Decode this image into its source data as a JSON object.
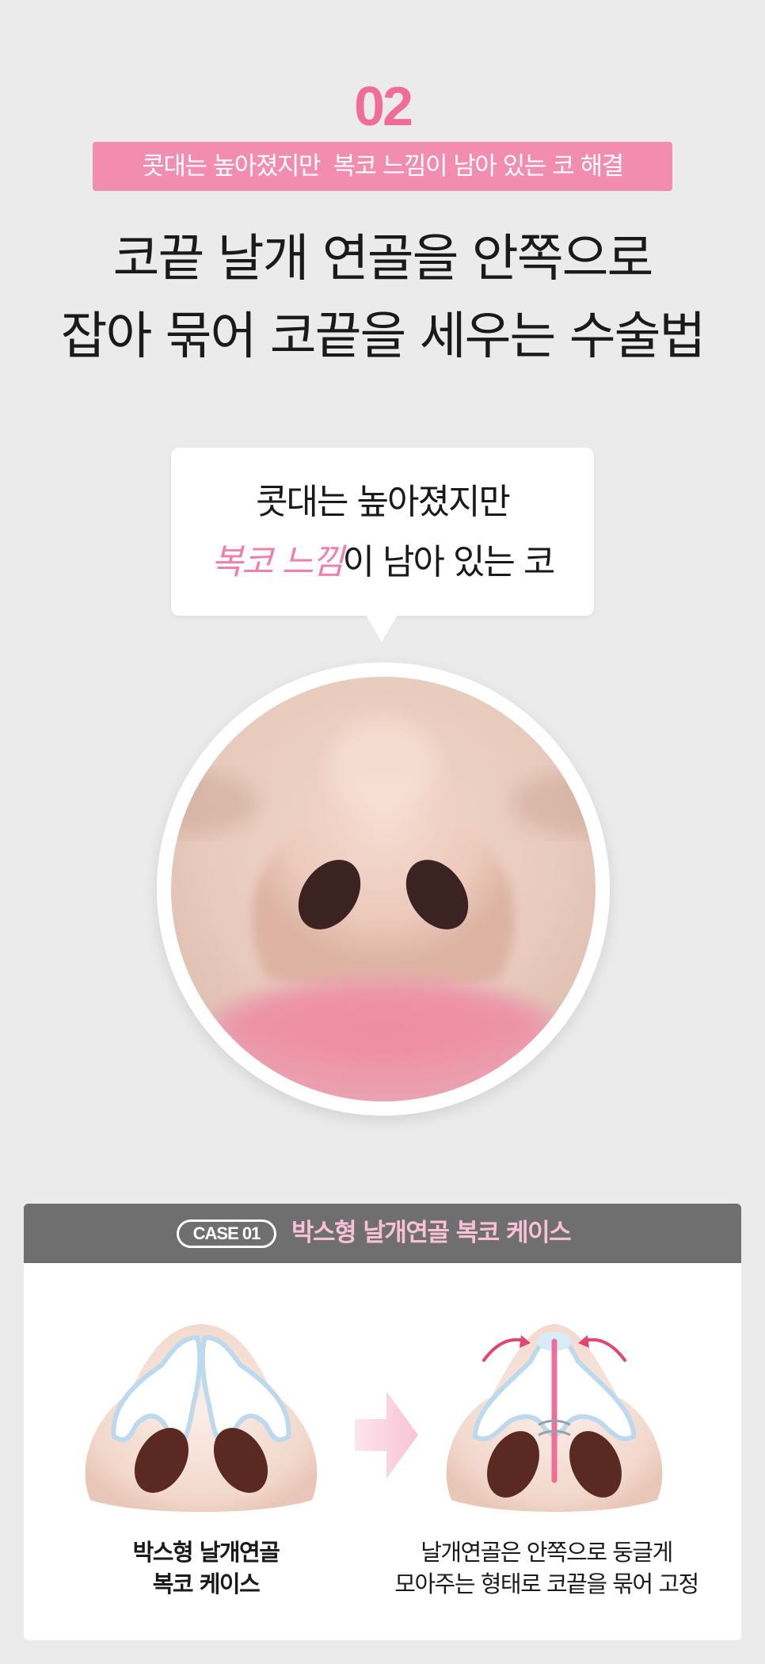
{
  "section": {
    "number": "02",
    "banner": "콧대는 높아졌지만  복코 느낌이 남아 있는 코 해결"
  },
  "headline": {
    "line1": "코끝 날개 연골을 안쪽으로",
    "line2": "잡아 묶어 코끝을 세우는 수술법"
  },
  "bubble": {
    "line1": "콧대는 높아졌지만",
    "line2_highlight": "복코 느낌",
    "line2_rest": "이 남아 있는 코"
  },
  "photo": {
    "subject": "nose-closeup-photo"
  },
  "case": {
    "badge": "CASE 01",
    "title": "박스형 날개연골 복코 케이스",
    "before_caption_line1": "박스형 날개연골",
    "before_caption_line2": "복코 케이스",
    "after_caption_line1": "날개연골은 안쪽으로 둥글게",
    "after_caption_line2": "모아주는 형태로 코끝을 묶어 고정"
  },
  "colors": {
    "accent_pink": "#f06d9a",
    "banner_pink": "#f28db0",
    "header_gray": "#6f6f6f",
    "header_title_pink": "#f9c1d6",
    "background": "#ebebeb"
  }
}
